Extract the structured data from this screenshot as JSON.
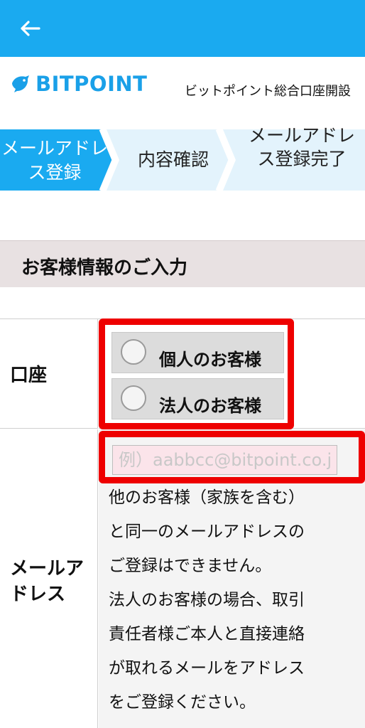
{
  "colors": {
    "brand": "#1aaaf0",
    "highlight": "#ee0000",
    "section_bg": "#e8e1e2",
    "input_bg": "#fbe4ea"
  },
  "header": {
    "back_icon": "arrow-left-icon"
  },
  "brand": {
    "logo_text": "BITPOINT",
    "logo_icon": "bird-icon",
    "subtitle": "ビットポイント総合口座開設"
  },
  "steps": [
    {
      "label": "メールアドレス登録",
      "active": true
    },
    {
      "label": "内容確認",
      "active": false
    },
    {
      "label": "メールアドレス登録完了",
      "active": false
    }
  ],
  "section": {
    "title": "お客様情報のご入力"
  },
  "form": {
    "account": {
      "label": "口座",
      "options": [
        {
          "label": "個人のお客様",
          "selected": false
        },
        {
          "label": "法人のお客様",
          "selected": false
        }
      ]
    },
    "email": {
      "label": "メールアドレス",
      "placeholder": "例）aabbcc@bitpoint.co.jp",
      "value": "",
      "note_lines": [
        "他のお客様（家族を含む）",
        "と同一のメールアドレスの",
        "ご登録はできません。",
        "法人のお客様の場合、取引",
        "責任者様ご本人と直接連絡",
        "が取れるメールをアドレス",
        "をご登録ください。"
      ]
    }
  }
}
